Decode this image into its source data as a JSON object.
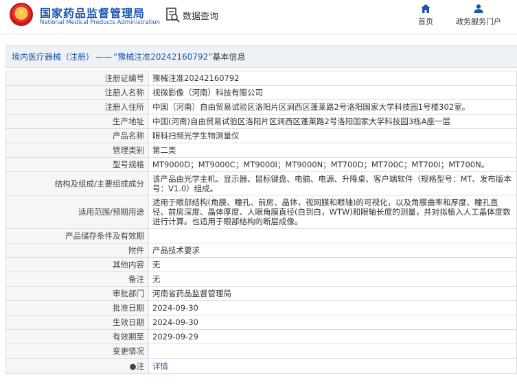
{
  "header": {
    "brand_cn": "国家药品监督管理局",
    "brand_en": "National Medical Products Administration",
    "search_label": "数据查询",
    "nav_home": "首页",
    "nav_service": "政务服务门户"
  },
  "breadcrumb": {
    "category": "境内医疗器械（注册）",
    "separator": "——",
    "registration": "“豫械注准20242160792”",
    "suffix": "基本信息"
  },
  "rows": [
    {
      "label": "注册证编号",
      "value": "豫械注准20242160792"
    },
    {
      "label": "注册人名称",
      "value": "视微影像（河南）科技有限公司"
    },
    {
      "label": "注册人住所",
      "value": "中国（河南）自由贸易试验区洛阳片区涧西区蓬莱路2号洛阳国家大学科技园1号楼302室。"
    },
    {
      "label": "生产地址",
      "value": "中国(河南)自由贸易试验区洛阳片区涧西区蓬莱路2号洛阳国家大学科技园3栋A座一层"
    },
    {
      "label": "产品名称",
      "value": "眼科扫频光学生物测量仪"
    },
    {
      "label": "管理类别",
      "value": "第二类"
    },
    {
      "label": "型号规格",
      "value": "MT9000D；MT9000C；MT9000I；MT9000N；MT700D；MT700C；MT700I；MT700N。"
    },
    {
      "label": "结构及组成/主要组成成分",
      "value": "该产品由光学主机、显示器、鼠标键盘、电脑、电源、升降桌、客户端软件（规格型号：MT、发布版本号：V1.0）组成。"
    },
    {
      "label": "适用范围/预期用途",
      "value": "适用于眼部结构(角膜、瞳孔、前房、晶体，视网膜和眼轴)的可视化，以及角膜曲率和厚度、瞳孔直径、前房深度、晶体厚度、人眼角膜直径(白到白，WTW)和眼轴长度的测量，并对拟植入人工晶体度数进行计算。也适用于眼部结构的断层成像。"
    },
    {
      "label": "产品储存条件及有效期",
      "value": ""
    },
    {
      "label": "附件",
      "value": "产品技术要求"
    },
    {
      "label": "其他内容",
      "value": "无"
    },
    {
      "label": "备注",
      "value": "无"
    },
    {
      "label": "审批部门",
      "value": "河南省药品监督管理局"
    },
    {
      "label": "批准日期",
      "value": "2024-09-30"
    },
    {
      "label": "生效日期",
      "value": "2024-09-30"
    },
    {
      "label": "有效期至",
      "value": "2029-09-29"
    },
    {
      "label": "变更情况",
      "value": ""
    },
    {
      "label": "●注",
      "value": "详情"
    }
  ]
}
